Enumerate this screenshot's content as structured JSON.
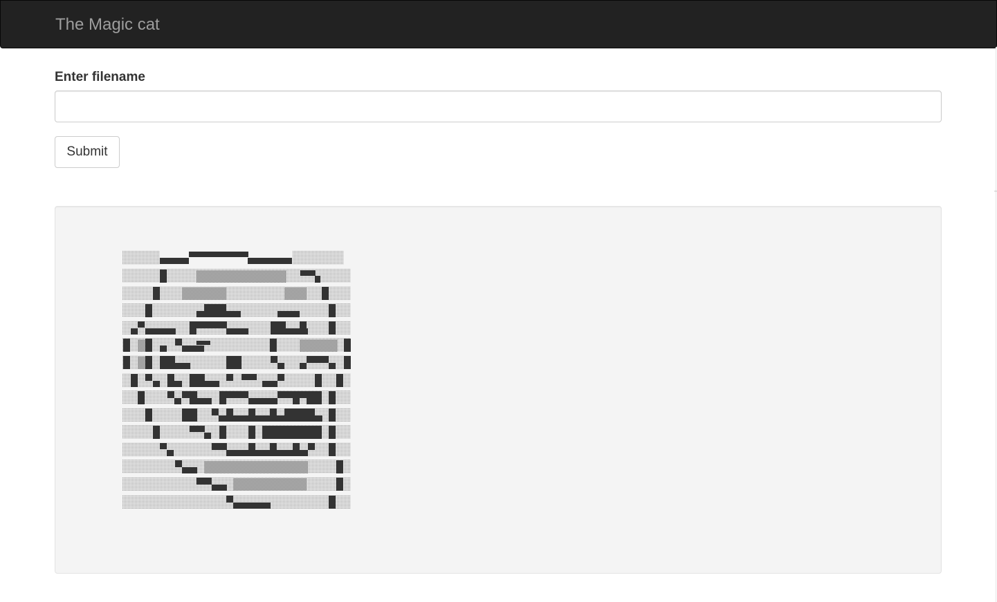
{
  "navbar": {
    "brand": "The Magic cat"
  },
  "form": {
    "label": "Enter filename",
    "input_value": "",
    "input_placeholder": "",
    "submit_label": "Submit"
  },
  "output": {
    "art_description_icon": "cat-ascii-art"
  }
}
